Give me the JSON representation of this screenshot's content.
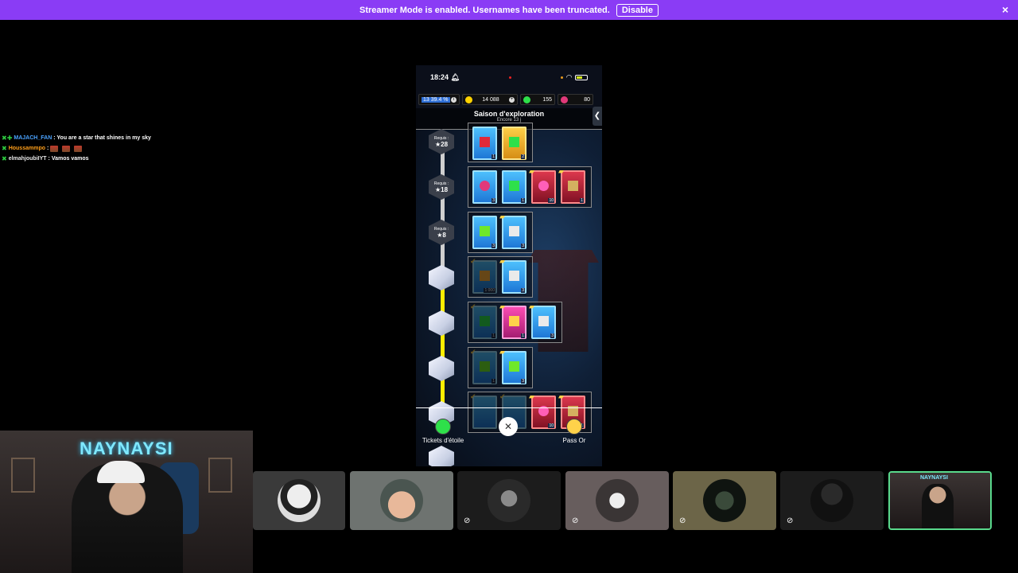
{
  "banner": {
    "message": "Streamer Mode is enabled. Usernames have been truncated.",
    "disable_label": "Disable",
    "close_icon": "×"
  },
  "chat": [
    {
      "user": "MAJACH_FAN",
      "text": ": You are a star that shines in my sky",
      "color": "#4aa3ff"
    },
    {
      "user": "Houssammpo",
      "text": ":",
      "color": "#ff9f1a"
    },
    {
      "user": "elmahjoubiIYT",
      "text": ": Vamos vamos",
      "color": "#e8e8e8"
    }
  ],
  "phone": {
    "time": "18:24",
    "resources": {
      "progress": "13 39.4 %",
      "coins": "14 088",
      "gems": "155",
      "stars": "80"
    },
    "season_title": "Saison d'exploration",
    "season_sub": "Encore 13 j",
    "side_tab": "❮",
    "nodes": [
      {
        "req": "Requis :",
        "stars": "28"
      },
      {
        "req": "Requis :",
        "stars": "18"
      },
      {
        "req": "Requis :",
        "stars": "8"
      }
    ],
    "rows": [
      {
        "cards": [
          {
            "q": "1"
          },
          {
            "q": "2"
          }
        ]
      },
      {
        "cards": [
          {
            "q": "3"
          },
          {
            "q": "1"
          },
          {
            "q": "10"
          },
          {
            "q": "1"
          }
        ]
      },
      {
        "cards": [
          {
            "q": "3"
          },
          {
            "q": "3"
          }
        ]
      },
      {
        "cards": [
          {
            "q": "1 000"
          },
          {
            "q": "3"
          }
        ]
      },
      {
        "cards": [
          {
            "q": "1"
          },
          {
            "q": "1"
          },
          {
            "q": "3"
          }
        ]
      },
      {
        "cards": [
          {
            "q": "1"
          },
          {
            "q": "3"
          }
        ]
      },
      {
        "cards": [
          {
            "q": ""
          },
          {
            "q": ""
          },
          {
            "q": "10"
          },
          {
            "q": "1"
          }
        ]
      }
    ],
    "overlay": {
      "left_label": "Tickets d'étoile",
      "right_label": "Pass Or",
      "close_icon": "✕"
    }
  },
  "webcam": {
    "neon_sign": "NAYNAYSI"
  },
  "participants": [
    {
      "name": "participant-1",
      "bg": "#3a3a3a",
      "muted": false
    },
    {
      "name": "participant-2",
      "bg": "#6e7370",
      "muted": false
    },
    {
      "name": "participant-3",
      "bg": "#1c1c1c",
      "muted": true
    },
    {
      "name": "participant-4",
      "bg": "#675d5d",
      "muted": true
    },
    {
      "name": "participant-5",
      "bg": "#6c6548",
      "muted": true
    },
    {
      "name": "participant-6",
      "bg": "#1c1c1c",
      "muted": true
    },
    {
      "name": "participant-7",
      "bg": "#2c2424",
      "muted": false
    }
  ],
  "colors": {
    "banner": "#8a3cf5",
    "active_tile": "#59d98c",
    "track_progress": "#ffee00"
  }
}
